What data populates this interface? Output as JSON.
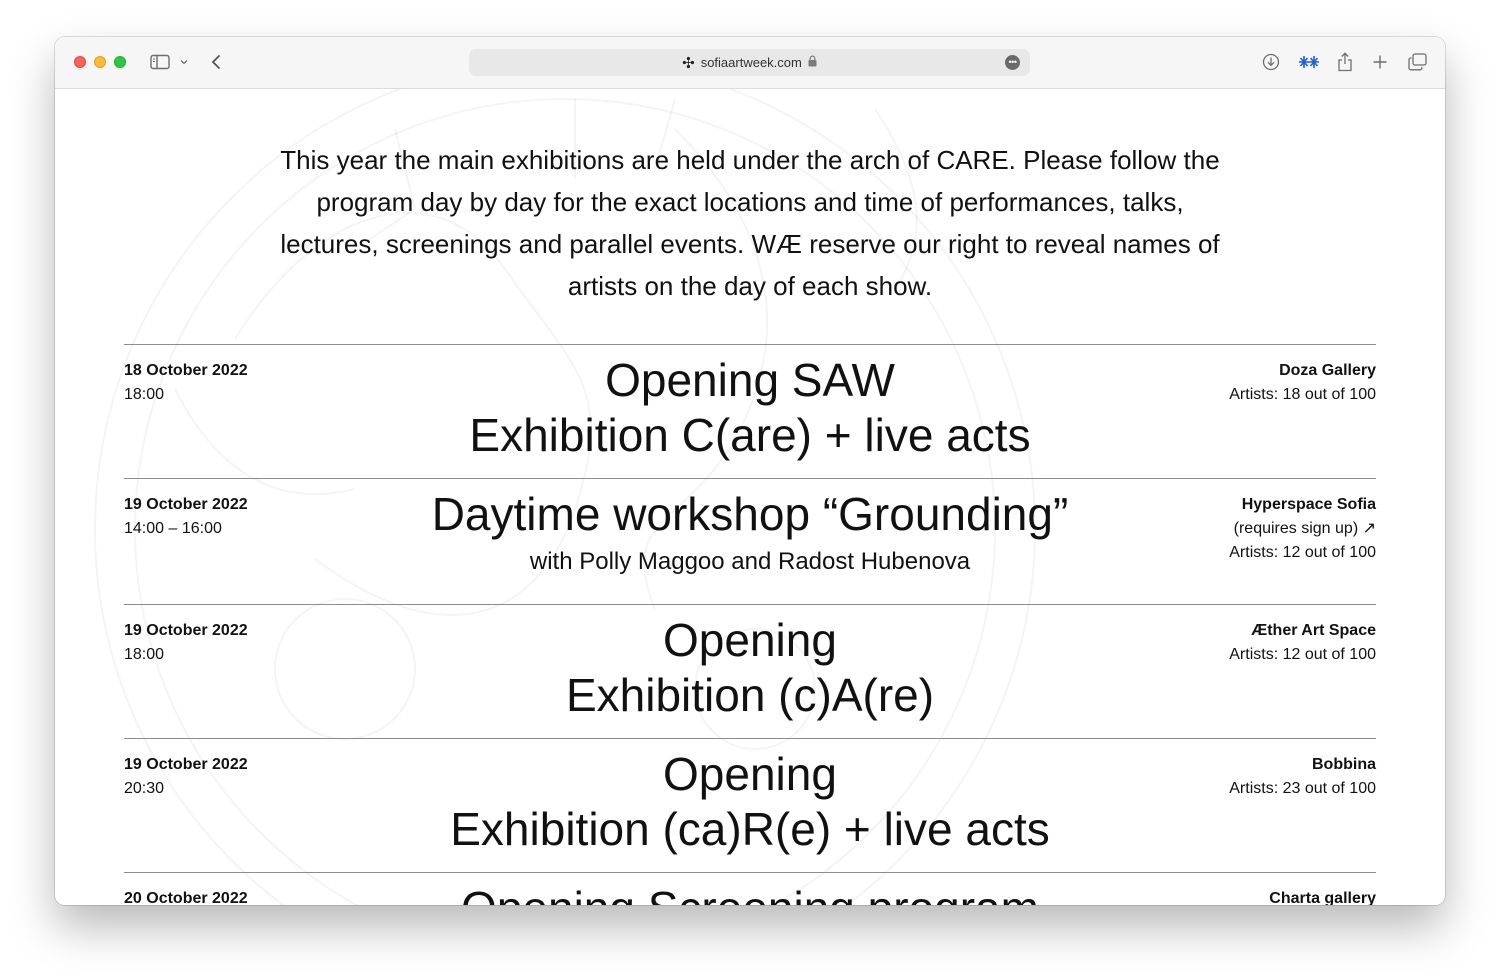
{
  "browser": {
    "url": "sofiaartweek.com",
    "site_logo": "✣",
    "lock": "🔒",
    "more": "•••",
    "back": "‹"
  },
  "intro": {
    "line1": "This year the main exhibitions are held under the arch of CARE. Please follow the",
    "line2": "program day by day for the exact locations and time of performances, talks,",
    "line3": "lectures, screenings and parallel events. WÆ reserve our right to reveal names of",
    "line4": "artists on the day of each show."
  },
  "events": [
    {
      "date": "18 October 2022",
      "time": "18:00",
      "title_line1": "Opening SAW",
      "title_line2": "Exhibition C(are) + live acts",
      "venue": "Doza Gallery",
      "artists": "Artists: 18 out of 100"
    },
    {
      "date": "19 October 2022",
      "time": "14:00 – 16:00",
      "title_line1": "Daytime workshop “Grounding”",
      "subtitle": "with Polly Maggoo and Radost Hubenova",
      "venue": "Hyperspace Sofia",
      "note": "(requires sign up) ↗",
      "artists": "Artists: 12 out of 100"
    },
    {
      "date": "19 October 2022",
      "time": "18:00",
      "title_line1": "Opening",
      "title_line2": "Exhibition (c)A(re)",
      "venue": "Æther Art Space",
      "artists": "Artists: 12 out of 100"
    },
    {
      "date": "19 October 2022",
      "time": "20:30",
      "title_line1": "Opening",
      "title_line2": "Exhibition (ca)R(e) + live acts",
      "venue": "Bobbina",
      "artists": "Artists: 23 out of 100"
    },
    {
      "date": "20 October 2022",
      "title_line1": "Opening Screening program",
      "venue": "Charta gallery"
    }
  ]
}
